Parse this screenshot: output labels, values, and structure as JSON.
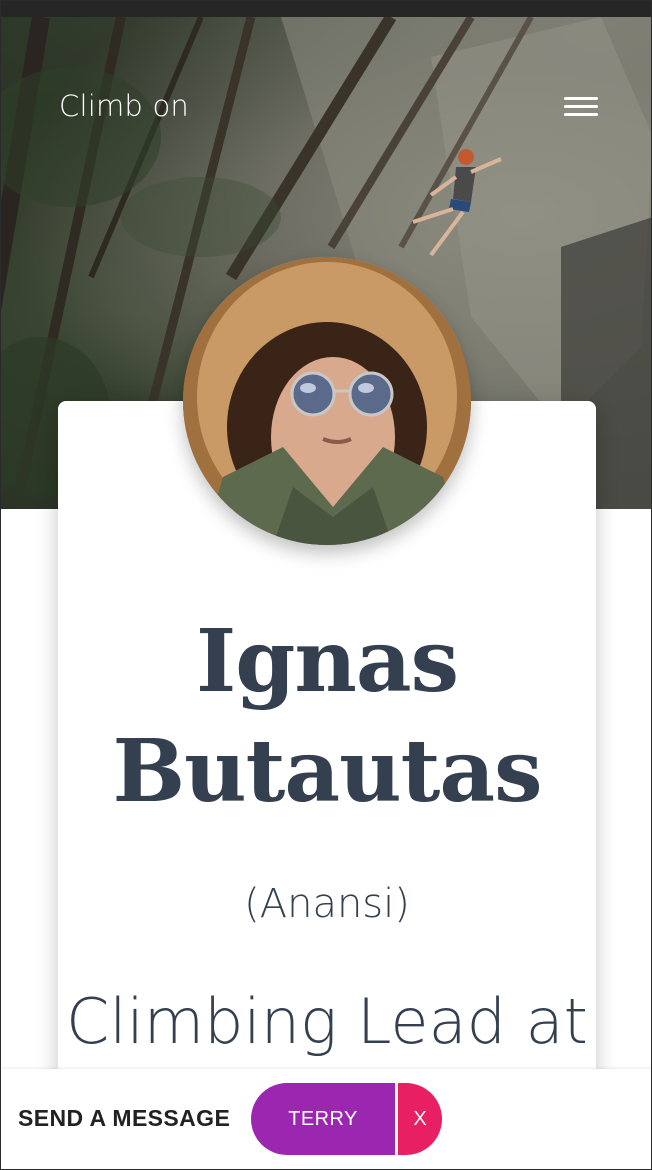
{
  "header": {
    "brand": "Climb on",
    "menu_icon": "hamburger-menu-icon"
  },
  "profile": {
    "name": "Ignas Butautas",
    "nickname": "(Anansi)",
    "role": "Climbing Lead at"
  },
  "message_bar": {
    "label": "SEND A MESSAGE",
    "recipient": "TERRY",
    "close_label": "X"
  },
  "colors": {
    "text_dark": "#34404f",
    "chip_purple": "#9b27b0",
    "chip_pink": "#e81f63"
  }
}
